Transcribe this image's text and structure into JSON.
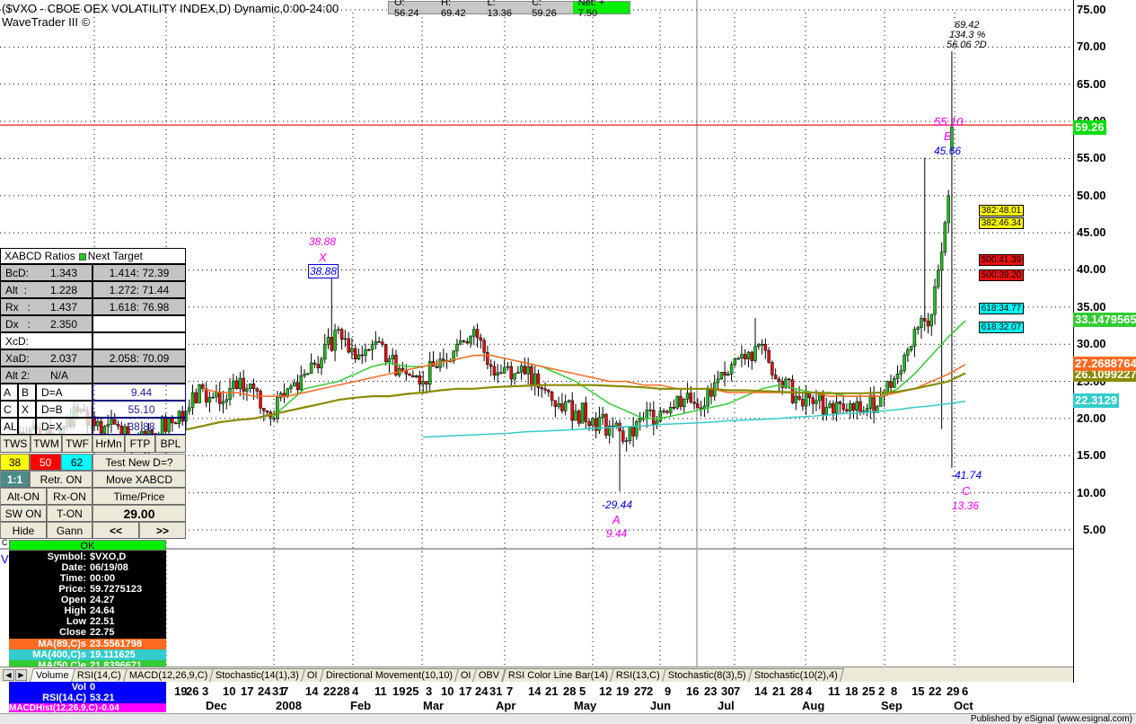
{
  "header": {
    "title": "($VXO - CBOE OEX VOLATILITY INDEX,D) Dynamic,0:00-24:00",
    "subtitle": "WaveTrader III ©",
    "open": "O: 56.24",
    "high": "H: 69.42",
    "low": "L: 13.36",
    "close": "C: 59.26",
    "net": "Net: + 7.50"
  },
  "colors": {
    "up": "#22bb22",
    "down": "#e01010",
    "ma50": "#33cc33",
    "ma89": "#ff6a20",
    "ma_olive": "#8a8a00",
    "ma400": "#33cccc",
    "resistance": "#ff0000"
  },
  "chart_data": {
    "type": "candlestick",
    "ylim": [
      2,
      77
    ],
    "y_ticks": [
      "75.00",
      "70.00",
      "65.00",
      "60.00",
      "55.00",
      "50.00",
      "45.00",
      "40.00",
      "35.00",
      "30.00",
      "25.00",
      "20.00",
      "15.00",
      "10.00",
      "5.00"
    ],
    "y_tick_values": [
      75,
      70,
      65,
      60,
      55,
      50,
      45,
      40,
      35,
      30,
      25,
      20,
      15,
      10,
      5
    ],
    "pre_week_closes": [
      18,
      19,
      17,
      20,
      21,
      18,
      19,
      17,
      18,
      20
    ],
    "weeks": [
      "19",
      "26",
      "3",
      "10",
      "17",
      "24",
      "31",
      "7",
      "14",
      "22",
      "28",
      "4",
      "11",
      "19",
      "25",
      "3",
      "10",
      "17",
      "24",
      "31",
      "7",
      "14",
      "21",
      "28",
      "5",
      "12",
      "19",
      "27",
      "2",
      "9",
      "16",
      "23",
      "30",
      "7",
      "14",
      "21",
      "28",
      "4",
      "11",
      "18",
      "25",
      "2",
      "8",
      "15",
      "22",
      "29",
      "6"
    ],
    "months": [
      "Dec",
      "2008",
      "Feb",
      "Mar",
      "Apr",
      "May",
      "Jun",
      "Jul",
      "Aug",
      "Sep",
      "Oct"
    ],
    "weekly_close": [
      21,
      24,
      22,
      24,
      24,
      20,
      24,
      26,
      28,
      32,
      28,
      30,
      28,
      26,
      25,
      28,
      30,
      32,
      27,
      27,
      26,
      24,
      22,
      21,
      20,
      19,
      17,
      20,
      21,
      23,
      22,
      23,
      26,
      28,
      30,
      25,
      23,
      22,
      22,
      21,
      21,
      23,
      26,
      32,
      34,
      50,
      59.26
    ],
    "extremes": [
      {
        "week": 9,
        "high": 38.88
      },
      {
        "week": 26,
        "low": 10.2
      },
      {
        "week": 34,
        "high": 33.5
      },
      {
        "week": 44,
        "high": 55.1
      },
      {
        "week": 45,
        "low": 18.6
      }
    ],
    "last_bar": {
      "open": 56.24,
      "high": 69.42,
      "low": 13.36,
      "close": 59.26
    },
    "resistance_level": 59.5,
    "series": [
      {
        "name": "MA(50,C)e",
        "color": "#33cc33",
        "values": [
          null,
          null,
          null,
          null,
          null,
          20,
          22,
          24,
          24.5,
          25,
          26,
          27,
          27.5,
          27,
          27,
          27.5,
          28,
          28.5,
          28.5,
          28,
          27.5,
          27,
          26,
          25,
          23.5,
          22,
          21,
          20,
          20,
          20.5,
          21,
          21.5,
          22,
          23,
          24,
          24.5,
          24,
          23.5,
          23.5,
          23,
          23,
          23,
          24,
          26,
          28.5,
          31,
          33.15
        ]
      },
      {
        "name": "MA(89,C)s",
        "color": "#ff6a20",
        "values": [
          null,
          24,
          23.5,
          23.5,
          23,
          23,
          23,
          23.5,
          24,
          24.5,
          25,
          25.5,
          26,
          26.5,
          27,
          27.5,
          28,
          28.5,
          28.5,
          28,
          27.5,
          27,
          26.5,
          26,
          25.5,
          25,
          25,
          24.5,
          24.5,
          24,
          24,
          24,
          23.5,
          23.5,
          23.5,
          23.5,
          23.5,
          23.5,
          23,
          23,
          23,
          23,
          23.5,
          24,
          25,
          26,
          27.27
        ]
      },
      {
        "name": "MA olive",
        "color": "#8a8a00",
        "values": [
          18.5,
          19,
          19.5,
          19.8,
          20,
          20.5,
          21,
          21.5,
          22,
          22.5,
          22.8,
          23,
          23,
          23.3,
          23.5,
          23.8,
          24,
          24,
          24.2,
          24.3,
          24.4,
          24.5,
          24.5,
          24.5,
          24.5,
          24.4,
          24.3,
          24.2,
          24,
          24,
          24,
          24,
          23.8,
          23.8,
          23.7,
          23.6,
          23.5,
          23.5,
          23.4,
          23.4,
          23.4,
          23.5,
          23.6,
          24,
          24.5,
          25,
          26.1
        ]
      },
      {
        "name": "MA(400,C)s",
        "color": "#33cccc",
        "values": [
          null,
          null,
          null,
          null,
          null,
          null,
          null,
          null,
          null,
          null,
          null,
          null,
          null,
          null,
          17.5,
          17.6,
          17.7,
          17.8,
          17.9,
          18.0,
          18.2,
          18.3,
          18.4,
          18.5,
          18.7,
          18.8,
          18.9,
          19.0,
          19.2,
          19.3,
          19.4,
          19.5,
          19.7,
          19.8,
          19.9,
          20.0,
          20.2,
          20.3,
          20.5,
          20.7,
          20.8,
          21.0,
          21.2,
          21.5,
          21.7,
          22.0,
          22.31
        ]
      }
    ]
  },
  "axis_tags": {
    "last": "59.26",
    "ma50": "33.1479565",
    "ma89": "27.2688764",
    "olive": "26.1099227",
    "ma400": "22.3129"
  },
  "fib": [
    {
      "label": "382:48.01",
      "color": "#ffff00"
    },
    {
      "label": "382:46.34",
      "color": "#ffff00"
    },
    {
      "label": "500:41.39",
      "color": "#ee1111"
    },
    {
      "label": "500:39.20",
      "color": "#ee1111"
    },
    {
      "label": "618:34.77",
      "color": "#00ffff"
    },
    {
      "label": "618:32.07",
      "color": "#00ffff"
    }
  ],
  "annotations": {
    "x_top": "38.88",
    "x_label": "X",
    "x_box": "38.88",
    "a_pct": "-29.44",
    "a_label": "A",
    "a_val": "9.44",
    "b_top": "55.10",
    "b_label": "B",
    "b_val": "45.66",
    "d_val": "69.42",
    "d_pct": "134.3 %",
    "d_proj": "56.06 ?D",
    "c_pct": "-41.74",
    "c_label": "C",
    "c_val": "13.36"
  },
  "panel": {
    "header": "XABCD Ratios",
    "header2": "Next Target",
    "rows": [
      {
        "k": "BcD:",
        "v": "1.343",
        "t": "1.414: 72.39"
      },
      {
        "k": "Alt  :",
        "v": "1.228",
        "t": "1.272: 71.44"
      },
      {
        "k": "Rx   :",
        "v": "1.437",
        "t": "1.618: 76.98"
      },
      {
        "k": "Dx   :",
        "v": "2.350",
        "t": ""
      },
      {
        "k": "XcD:",
        "v": "",
        "t": ""
      },
      {
        "k": "XaD:",
        "v": "2.037",
        "t": "2.058: 70.09"
      },
      {
        "k": "Alt 2:",
        "v": "N/A",
        "t": ""
      }
    ],
    "points": [
      {
        "a": "A",
        "b": "B",
        "c": "D=A",
        "v": "9.44"
      },
      {
        "a": "C",
        "b": "X",
        "c": "D=B",
        "v": "55.10"
      },
      {
        "a": "AL",
        "b": "",
        "c": "D=X",
        "v": "38.88"
      }
    ],
    "buttons1": [
      "TWS",
      "TWM",
      "TWF",
      "HrMn",
      "FTP",
      "BPL"
    ],
    "fibs": [
      "38",
      "50",
      "62"
    ],
    "test": "Test New D=?",
    "ratio": "1:1",
    "retr": "Retr. ON",
    "move": "Move XABCD",
    "alt_on": "Alt-ON",
    "rx_on": "Rx-ON",
    "time_price": "Time/Price",
    "sw_on": "SW ON",
    "t_on": "T-ON",
    "value": "29.00",
    "hide": "Hide",
    "gann": "Gann",
    "prev": "<<",
    "next": ">>"
  },
  "info": {
    "c": "C",
    "ok": "OK",
    "v": "V",
    "lines": [
      {
        "k": "Symbol:",
        "v": "$VXO,D"
      },
      {
        "k": "Date:",
        "v": "06/19/08"
      },
      {
        "k": "Time:",
        "v": "00:00"
      },
      {
        "k": "Price:",
        "v": "59.7275123"
      },
      {
        "k": "Open",
        "v": "24.27"
      },
      {
        "k": "High",
        "v": "24.64"
      },
      {
        "k": "Low",
        "v": "22.51"
      },
      {
        "k": "Close",
        "v": "22.75"
      }
    ],
    "ma89": {
      "k": "MA(89,C)s",
      "v": "23.5561798"
    },
    "ma400": {
      "k": "MA(400,C)s",
      "v": "19.111625"
    },
    "ma50": {
      "k": "MA(50,C)e",
      "v": "21.8396671"
    },
    "vol": {
      "k": "Vol",
      "v": "0"
    },
    "rsi": {
      "k": "RSI(14,C)",
      "v": "53.21"
    },
    "macd": {
      "k": "MACDHist(12,26,9,C)",
      "v": "-0.04"
    }
  },
  "tabs": [
    "Volume",
    "RSI(14,C)",
    "MACD(12,26,9,C)",
    "Stochastic(14(1),3)",
    "OI",
    "Directional Movement(10,10)",
    "OI",
    "OBV",
    "RSI Color Line Bar(14)",
    "RSI(13,C)",
    "Stochastic(8(3),5)",
    "Stochastic(10(2),4)"
  ],
  "status": "Published by eSignal (www.esignal.com)"
}
